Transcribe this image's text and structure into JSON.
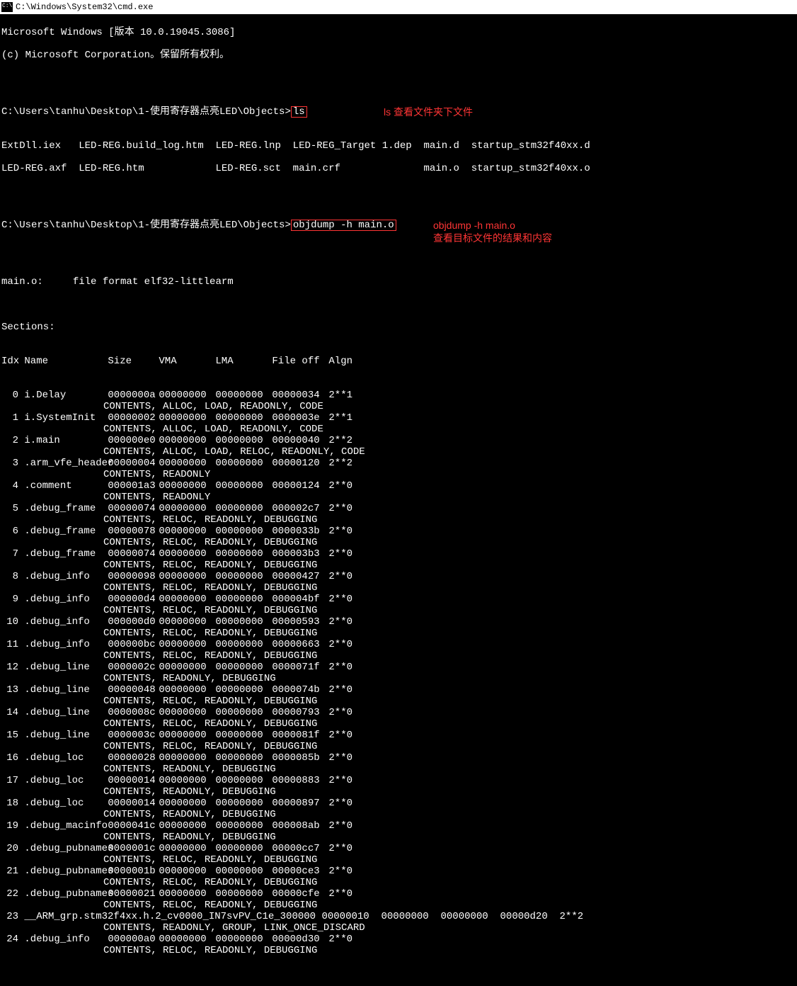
{
  "title": "C:\\Windows\\System32\\cmd.exe",
  "intro1": "Microsoft Windows [版本 10.0.19045.3086]",
  "intro2": "(c) Microsoft Corporation。保留所有权利。",
  "prompt1": "C:\\Users\\tanhu\\Desktop\\1-使用寄存器点亮LED\\Objects>",
  "cmd1": "ls",
  "anno1": "ls 查看文件夹下文件",
  "ls_row1": "ExtDll.iex   LED-REG.build_log.htm  LED-REG.lnp  LED-REG_Target 1.dep  main.d  startup_stm32f40xx.d",
  "ls_row2": "LED-REG.axf  LED-REG.htm            LED-REG.sct  main.crf              main.o  startup_stm32f40xx.o",
  "prompt2": "C:\\Users\\tanhu\\Desktop\\1-使用寄存器点亮LED\\Objects>",
  "cmd2": "objdump -h main.o",
  "anno2a": "objdump -h main.o",
  "anno2b": "查看目标文件的结果和内容",
  "fmtline": "main.o:     file format elf32-littlearm",
  "sections_title": "Sections:",
  "hdr": {
    "idx": "Idx",
    "name": "Name",
    "size": "Size",
    "vma": "VMA",
    "lma": "LMA",
    "foff": "File off",
    "algn": "Algn"
  },
  "sections": [
    {
      "idx": "0",
      "name": "i.Delay",
      "size": "0000000a",
      "vma": "00000000",
      "lma": "00000000",
      "foff": "00000034",
      "algn": "2**1",
      "flags": "CONTENTS, ALLOC, LOAD, READONLY, CODE"
    },
    {
      "idx": "1",
      "name": "i.SystemInit",
      "size": "00000002",
      "vma": "00000000",
      "lma": "00000000",
      "foff": "0000003e",
      "algn": "2**1",
      "flags": "CONTENTS, ALLOC, LOAD, READONLY, CODE"
    },
    {
      "idx": "2",
      "name": "i.main",
      "size": "000000e0",
      "vma": "00000000",
      "lma": "00000000",
      "foff": "00000040",
      "algn": "2**2",
      "flags": "CONTENTS, ALLOC, LOAD, RELOC, READONLY, CODE"
    },
    {
      "idx": "3",
      "name": ".arm_vfe_header",
      "size": "00000004",
      "vma": "00000000",
      "lma": "00000000",
      "foff": "00000120",
      "algn": "2**2",
      "flags": "CONTENTS, READONLY"
    },
    {
      "idx": "4",
      "name": ".comment",
      "size": "000001a3",
      "vma": "00000000",
      "lma": "00000000",
      "foff": "00000124",
      "algn": "2**0",
      "flags": "CONTENTS, READONLY"
    },
    {
      "idx": "5",
      "name": ".debug_frame",
      "size": "00000074",
      "vma": "00000000",
      "lma": "00000000",
      "foff": "000002c7",
      "algn": "2**0",
      "flags": "CONTENTS, RELOC, READONLY, DEBUGGING"
    },
    {
      "idx": "6",
      "name": ".debug_frame",
      "size": "00000078",
      "vma": "00000000",
      "lma": "00000000",
      "foff": "0000033b",
      "algn": "2**0",
      "flags": "CONTENTS, RELOC, READONLY, DEBUGGING"
    },
    {
      "idx": "7",
      "name": ".debug_frame",
      "size": "00000074",
      "vma": "00000000",
      "lma": "00000000",
      "foff": "000003b3",
      "algn": "2**0",
      "flags": "CONTENTS, RELOC, READONLY, DEBUGGING"
    },
    {
      "idx": "8",
      "name": ".debug_info",
      "size": "00000098",
      "vma": "00000000",
      "lma": "00000000",
      "foff": "00000427",
      "algn": "2**0",
      "flags": "CONTENTS, RELOC, READONLY, DEBUGGING"
    },
    {
      "idx": "9",
      "name": ".debug_info",
      "size": "000000d4",
      "vma": "00000000",
      "lma": "00000000",
      "foff": "000004bf",
      "algn": "2**0",
      "flags": "CONTENTS, RELOC, READONLY, DEBUGGING"
    },
    {
      "idx": "10",
      "name": ".debug_info",
      "size": "000000d0",
      "vma": "00000000",
      "lma": "00000000",
      "foff": "00000593",
      "algn": "2**0",
      "flags": "CONTENTS, RELOC, READONLY, DEBUGGING"
    },
    {
      "idx": "11",
      "name": ".debug_info",
      "size": "000000bc",
      "vma": "00000000",
      "lma": "00000000",
      "foff": "00000663",
      "algn": "2**0",
      "flags": "CONTENTS, RELOC, READONLY, DEBUGGING"
    },
    {
      "idx": "12",
      "name": ".debug_line",
      "size": "0000002c",
      "vma": "00000000",
      "lma": "00000000",
      "foff": "0000071f",
      "algn": "2**0",
      "flags": "CONTENTS, READONLY, DEBUGGING"
    },
    {
      "idx": "13",
      "name": ".debug_line",
      "size": "00000048",
      "vma": "00000000",
      "lma": "00000000",
      "foff": "0000074b",
      "algn": "2**0",
      "flags": "CONTENTS, RELOC, READONLY, DEBUGGING"
    },
    {
      "idx": "14",
      "name": ".debug_line",
      "size": "0000008c",
      "vma": "00000000",
      "lma": "00000000",
      "foff": "00000793",
      "algn": "2**0",
      "flags": "CONTENTS, RELOC, READONLY, DEBUGGING"
    },
    {
      "idx": "15",
      "name": ".debug_line",
      "size": "0000003c",
      "vma": "00000000",
      "lma": "00000000",
      "foff": "0000081f",
      "algn": "2**0",
      "flags": "CONTENTS, RELOC, READONLY, DEBUGGING"
    },
    {
      "idx": "16",
      "name": ".debug_loc",
      "size": "00000028",
      "vma": "00000000",
      "lma": "00000000",
      "foff": "0000085b",
      "algn": "2**0",
      "flags": "CONTENTS, READONLY, DEBUGGING"
    },
    {
      "idx": "17",
      "name": ".debug_loc",
      "size": "00000014",
      "vma": "00000000",
      "lma": "00000000",
      "foff": "00000883",
      "algn": "2**0",
      "flags": "CONTENTS, READONLY, DEBUGGING"
    },
    {
      "idx": "18",
      "name": ".debug_loc",
      "size": "00000014",
      "vma": "00000000",
      "lma": "00000000",
      "foff": "00000897",
      "algn": "2**0",
      "flags": "CONTENTS, READONLY, DEBUGGING"
    },
    {
      "idx": "19",
      "name": ".debug_macinfo",
      "size": "0000041c",
      "vma": "00000000",
      "lma": "00000000",
      "foff": "000008ab",
      "algn": "2**0",
      "flags": "CONTENTS, READONLY, DEBUGGING"
    },
    {
      "idx": "20",
      "name": ".debug_pubnames",
      "size": "0000001c",
      "vma": "00000000",
      "lma": "00000000",
      "foff": "00000cc7",
      "algn": "2**0",
      "flags": "CONTENTS, RELOC, READONLY, DEBUGGING"
    },
    {
      "idx": "21",
      "name": ".debug_pubnames",
      "size": "0000001b",
      "vma": "00000000",
      "lma": "00000000",
      "foff": "00000ce3",
      "algn": "2**0",
      "flags": "CONTENTS, RELOC, READONLY, DEBUGGING"
    },
    {
      "idx": "22",
      "name": ".debug_pubnames",
      "size": "00000021",
      "vma": "00000000",
      "lma": "00000000",
      "foff": "00000cfe",
      "algn": "2**0",
      "flags": "CONTENTS, RELOC, READONLY, DEBUGGING"
    },
    {
      "idx": "23",
      "name": "__ARM_grp.stm32f4xx.h.2_cv0000_IN7svPV_C1e_300000",
      "size": "00000010",
      "vma": "00000000",
      "lma": "00000000",
      "foff": "00000d20",
      "algn": "2**2",
      "flags": "CONTENTS, READONLY, GROUP, LINK_ONCE_DISCARD"
    },
    {
      "idx": "24",
      "name": ".debug_info",
      "size": "000000a0",
      "vma": "00000000",
      "lma": "00000000",
      "foff": "00000d30",
      "algn": "2**0",
      "flags": "CONTENTS, RELOC, READONLY, DEBUGGING"
    }
  ]
}
